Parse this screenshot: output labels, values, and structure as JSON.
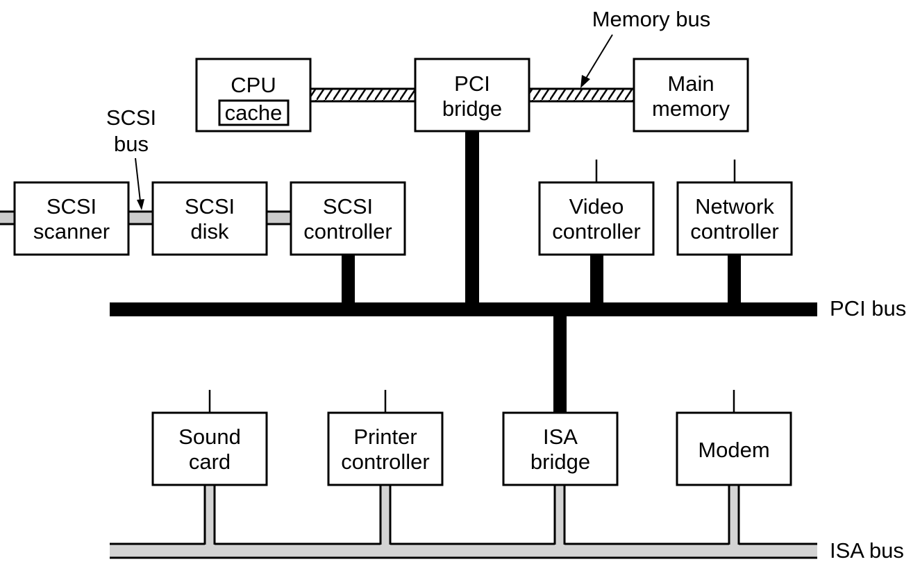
{
  "colors": {
    "pci_bus": "#000000",
    "isa_bus": "#d3d3d3",
    "scsi_bus": "#cccccc",
    "memory_bus": "hatched"
  },
  "labels": {
    "memory_bus": "Memory bus",
    "scsi_bus_1": "SCSI",
    "scsi_bus_2": "bus",
    "pci_bus": "PCI bus",
    "isa_bus": "ISA bus"
  },
  "boxes": {
    "cpu": {
      "line1": "CPU",
      "cache": "cache"
    },
    "pci_bridge": {
      "line1": "PCI",
      "line2": "bridge"
    },
    "main_memory": {
      "line1": "Main",
      "line2": "memory"
    },
    "scsi_scanner": {
      "line1": "SCSI",
      "line2": "scanner"
    },
    "scsi_disk": {
      "line1": "SCSI",
      "line2": "disk"
    },
    "scsi_controller": {
      "line1": "SCSI",
      "line2": "controller"
    },
    "video_controller": {
      "line1": "Video",
      "line2": "controller"
    },
    "network_controller": {
      "line1": "Network",
      "line2": "controller"
    },
    "sound_card": {
      "line1": "Sound",
      "line2": "card"
    },
    "printer_controller": {
      "line1": "Printer",
      "line2": "controller"
    },
    "isa_bridge": {
      "line1": "ISA",
      "line2": "bridge"
    },
    "modem": {
      "line1": "Modem"
    }
  }
}
